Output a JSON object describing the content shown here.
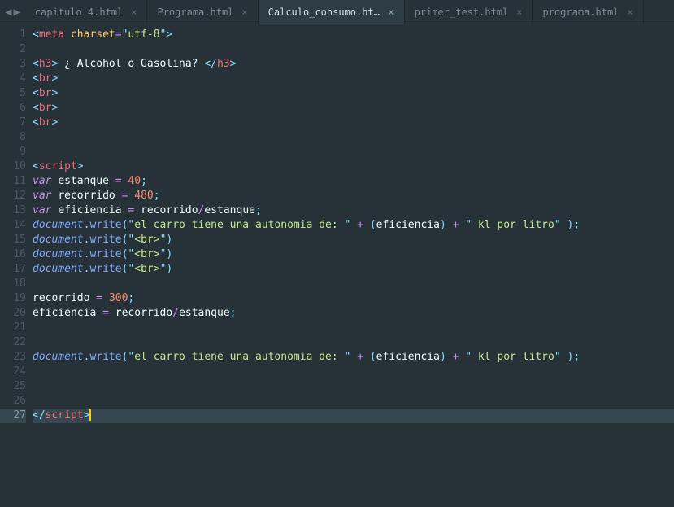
{
  "nav": {
    "back": "◀",
    "forward": "▶"
  },
  "tabs": [
    {
      "label": "capitulo 4.html",
      "active": false
    },
    {
      "label": "Programa.html",
      "active": false
    },
    {
      "label": "Calculo_consumo.html",
      "active": true
    },
    {
      "label": "primer_test.html",
      "active": false
    },
    {
      "label": "programa.html",
      "active": false
    }
  ],
  "close_glyph": "×",
  "line_count": 27,
  "current_line": 27,
  "code_lines": [
    [
      {
        "c": "punct",
        "t": "<"
      },
      {
        "c": "tagname",
        "t": "meta"
      },
      {
        "c": "plain",
        "t": " "
      },
      {
        "c": "attrname",
        "t": "charset"
      },
      {
        "c": "operator",
        "t": "="
      },
      {
        "c": "punct",
        "t": "\""
      },
      {
        "c": "string",
        "t": "utf-8"
      },
      {
        "c": "punct",
        "t": "\">"
      },
      {
        "c": "plain",
        "t": ""
      }
    ],
    [],
    [
      {
        "c": "punct",
        "t": "<"
      },
      {
        "c": "tagname",
        "t": "h3"
      },
      {
        "c": "punct",
        "t": ">"
      },
      {
        "c": "plain",
        "t": " ¿ Alcohol o Gasolina? "
      },
      {
        "c": "punct",
        "t": "</"
      },
      {
        "c": "tagname",
        "t": "h3"
      },
      {
        "c": "punct",
        "t": ">"
      }
    ],
    [
      {
        "c": "punct",
        "t": "<"
      },
      {
        "c": "tagname",
        "t": "br"
      },
      {
        "c": "punct",
        "t": ">"
      }
    ],
    [
      {
        "c": "punct",
        "t": "<"
      },
      {
        "c": "tagname",
        "t": "br"
      },
      {
        "c": "punct",
        "t": ">"
      }
    ],
    [
      {
        "c": "punct",
        "t": "<"
      },
      {
        "c": "tagname",
        "t": "br"
      },
      {
        "c": "punct",
        "t": ">"
      }
    ],
    [
      {
        "c": "punct",
        "t": "<"
      },
      {
        "c": "tagname",
        "t": "br"
      },
      {
        "c": "punct",
        "t": ">"
      }
    ],
    [],
    [],
    [
      {
        "c": "punct",
        "t": "<"
      },
      {
        "c": "tagname",
        "t": "script"
      },
      {
        "c": "punct",
        "t": ">"
      }
    ],
    [
      {
        "c": "keyword",
        "t": "var"
      },
      {
        "c": "plain",
        "t": " "
      },
      {
        "c": "varname",
        "t": "estanque"
      },
      {
        "c": "plain",
        "t": " "
      },
      {
        "c": "operator",
        "t": "="
      },
      {
        "c": "plain",
        "t": " "
      },
      {
        "c": "number",
        "t": "40"
      },
      {
        "c": "punct",
        "t": ";"
      }
    ],
    [
      {
        "c": "keyword",
        "t": "var"
      },
      {
        "c": "plain",
        "t": " "
      },
      {
        "c": "varname",
        "t": "recorrido"
      },
      {
        "c": "plain",
        "t": " "
      },
      {
        "c": "operator",
        "t": "="
      },
      {
        "c": "plain",
        "t": " "
      },
      {
        "c": "number",
        "t": "480"
      },
      {
        "c": "punct",
        "t": ";"
      }
    ],
    [
      {
        "c": "keyword",
        "t": "var"
      },
      {
        "c": "plain",
        "t": " "
      },
      {
        "c": "varname",
        "t": "eficiencia"
      },
      {
        "c": "plain",
        "t": " "
      },
      {
        "c": "operator",
        "t": "="
      },
      {
        "c": "plain",
        "t": " "
      },
      {
        "c": "varname",
        "t": "recorrido"
      },
      {
        "c": "operator",
        "t": "/"
      },
      {
        "c": "varname",
        "t": "estanque"
      },
      {
        "c": "punct",
        "t": ";"
      }
    ],
    [
      {
        "c": "object",
        "t": "document"
      },
      {
        "c": "punct",
        "t": "."
      },
      {
        "c": "method",
        "t": "write"
      },
      {
        "c": "punct",
        "t": "("
      },
      {
        "c": "punct",
        "t": "\""
      },
      {
        "c": "string",
        "t": "el carro tiene una autonomia de: "
      },
      {
        "c": "punct",
        "t": "\""
      },
      {
        "c": "plain",
        "t": " "
      },
      {
        "c": "operator",
        "t": "+"
      },
      {
        "c": "plain",
        "t": " "
      },
      {
        "c": "punct",
        "t": "("
      },
      {
        "c": "varname",
        "t": "eficiencia"
      },
      {
        "c": "punct",
        "t": ")"
      },
      {
        "c": "plain",
        "t": " "
      },
      {
        "c": "operator",
        "t": "+"
      },
      {
        "c": "plain",
        "t": " "
      },
      {
        "c": "punct",
        "t": "\""
      },
      {
        "c": "string",
        "t": " kl por litro"
      },
      {
        "c": "punct",
        "t": "\""
      },
      {
        "c": "plain",
        "t": " "
      },
      {
        "c": "punct",
        "t": ");"
      }
    ],
    [
      {
        "c": "object",
        "t": "document"
      },
      {
        "c": "punct",
        "t": "."
      },
      {
        "c": "method",
        "t": "write"
      },
      {
        "c": "punct",
        "t": "("
      },
      {
        "c": "punct",
        "t": "\""
      },
      {
        "c": "string",
        "t": "<br>"
      },
      {
        "c": "punct",
        "t": "\""
      },
      {
        "c": "punct",
        "t": ")"
      }
    ],
    [
      {
        "c": "object",
        "t": "document"
      },
      {
        "c": "punct",
        "t": "."
      },
      {
        "c": "method",
        "t": "write"
      },
      {
        "c": "punct",
        "t": "("
      },
      {
        "c": "punct",
        "t": "\""
      },
      {
        "c": "string",
        "t": "<br>"
      },
      {
        "c": "punct",
        "t": "\""
      },
      {
        "c": "punct",
        "t": ")"
      }
    ],
    [
      {
        "c": "object",
        "t": "document"
      },
      {
        "c": "punct",
        "t": "."
      },
      {
        "c": "method",
        "t": "write"
      },
      {
        "c": "punct",
        "t": "("
      },
      {
        "c": "punct",
        "t": "\""
      },
      {
        "c": "string",
        "t": "<br>"
      },
      {
        "c": "punct",
        "t": "\""
      },
      {
        "c": "punct",
        "t": ")"
      }
    ],
    [],
    [
      {
        "c": "varname",
        "t": "recorrido"
      },
      {
        "c": "plain",
        "t": " "
      },
      {
        "c": "operator",
        "t": "="
      },
      {
        "c": "plain",
        "t": " "
      },
      {
        "c": "number",
        "t": "300"
      },
      {
        "c": "punct",
        "t": ";"
      }
    ],
    [
      {
        "c": "varname",
        "t": "eficiencia"
      },
      {
        "c": "plain",
        "t": " "
      },
      {
        "c": "operator",
        "t": "="
      },
      {
        "c": "plain",
        "t": " "
      },
      {
        "c": "varname",
        "t": "recorrido"
      },
      {
        "c": "operator",
        "t": "/"
      },
      {
        "c": "varname",
        "t": "estanque"
      },
      {
        "c": "punct",
        "t": ";"
      }
    ],
    [],
    [],
    [
      {
        "c": "object",
        "t": "document"
      },
      {
        "c": "punct",
        "t": "."
      },
      {
        "c": "method",
        "t": "write"
      },
      {
        "c": "punct",
        "t": "("
      },
      {
        "c": "punct",
        "t": "\""
      },
      {
        "c": "string",
        "t": "el carro tiene una autonomia de: "
      },
      {
        "c": "punct",
        "t": "\""
      },
      {
        "c": "plain",
        "t": " "
      },
      {
        "c": "operator",
        "t": "+"
      },
      {
        "c": "plain",
        "t": " "
      },
      {
        "c": "punct",
        "t": "("
      },
      {
        "c": "varname",
        "t": "eficiencia"
      },
      {
        "c": "punct",
        "t": ")"
      },
      {
        "c": "plain",
        "t": " "
      },
      {
        "c": "operator",
        "t": "+"
      },
      {
        "c": "plain",
        "t": " "
      },
      {
        "c": "punct",
        "t": "\""
      },
      {
        "c": "string",
        "t": " kl por litro"
      },
      {
        "c": "punct",
        "t": "\""
      },
      {
        "c": "plain",
        "t": " "
      },
      {
        "c": "punct",
        "t": ");"
      }
    ],
    [],
    [],
    [],
    [
      {
        "c": "punct",
        "t": "</"
      },
      {
        "c": "tagname",
        "t": "script"
      },
      {
        "c": "punct",
        "t": ">"
      },
      {
        "c": "cursor",
        "t": ""
      }
    ]
  ]
}
